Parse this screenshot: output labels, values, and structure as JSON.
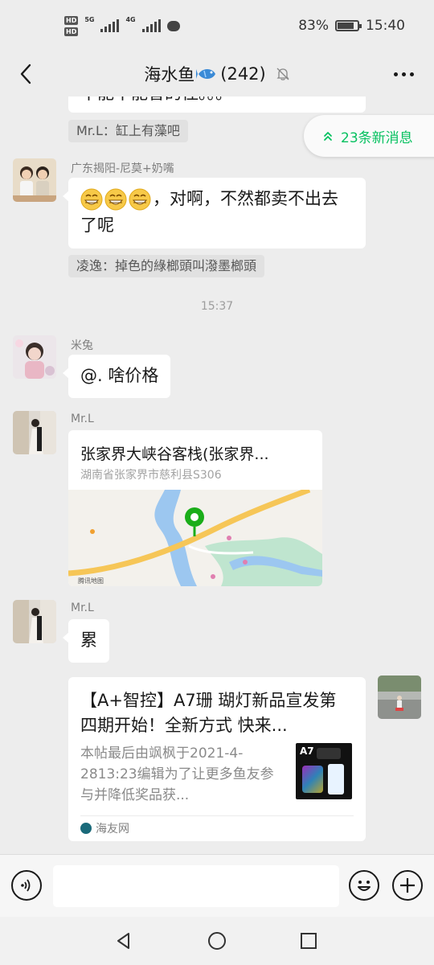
{
  "status_bar": {
    "hd1": "HD",
    "hd2": "HD",
    "net1": "5G",
    "net2": "4G",
    "battery_percent": "83%",
    "battery_level": 0.83,
    "time": "15:40"
  },
  "nav": {
    "title": "海水鱼",
    "member_count": "(242)",
    "icons": {
      "back": "back-arrow-icon",
      "fish": "fish-icon",
      "mute": "mute-bell-icon",
      "more": "more-icon"
    }
  },
  "new_messages": {
    "label": "23条新消息",
    "icon": "double-chevron-up-icon",
    "color": "#07c160"
  },
  "messages": {
    "m0_partial": "不能不能香的住。。。",
    "m0_quote": "Mr.L：缸上有藻吧",
    "m1_sender": "广东揭阳-尼莫+奶嘴",
    "m1_text_line1": "，对啊，不然都卖不出去",
    "m1_text_line2": "了呢",
    "m1_quote": "凌逸：掉色的綠榔頭叫潑墨榔頭",
    "time_divider": "15:37",
    "m2_sender": "米兔",
    "m2_text": "@. 啥价格",
    "m3_sender": "Mr.L",
    "m3_loc_title": "张家界大峡谷客栈(张家界...",
    "m3_loc_addr": "湖南省张家界市慈利县S306",
    "m3_map_attribution": "腾讯地图",
    "m4_sender": "Mr.L",
    "m4_text": "累",
    "m5_link_title": "【A+智控】A7珊 瑚灯新品宣发第四期开始！全新方式 快来...",
    "m5_link_desc": "本帖最后由飒枫于2021-4-2813:23编辑为了让更多鱼友参与并降低奖品获...",
    "m5_thumb_label": "A7",
    "m5_source": "海友网"
  },
  "input_bar": {
    "placeholder": "",
    "icons": {
      "voice": "voice-icon",
      "emoji": "emoji-icon",
      "plus": "plus-icon"
    }
  },
  "system_nav": {
    "icons": [
      "back-triangle-icon",
      "home-circle-icon",
      "recent-square-icon"
    ]
  }
}
